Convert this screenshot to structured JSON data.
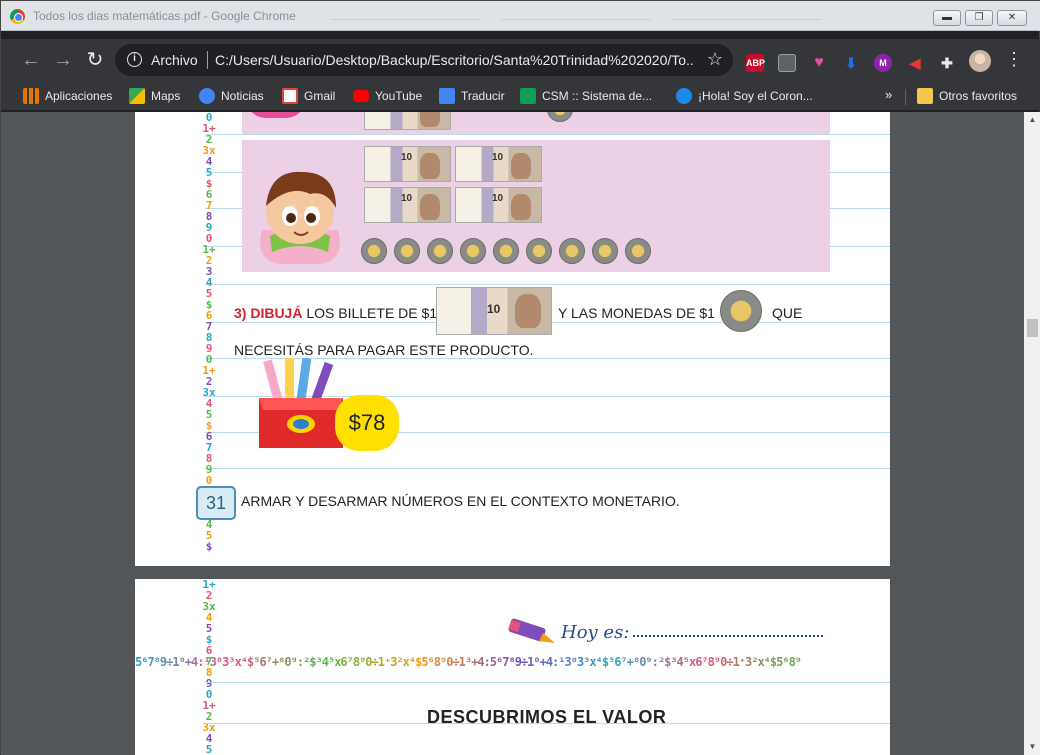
{
  "window": {
    "title": "Todos los dias matemáticas.pdf - Google Chrome",
    "minimize_label": "▬",
    "restore_label": "❐",
    "close_label": "✕"
  },
  "toolbar": {
    "back_icon": "←",
    "forward_icon": "→",
    "reload_icon": "↻",
    "scheme_label": "Archivo",
    "url": "C:/Users/Usuario/Desktop/Backup/Escritorio/Santa%20Trinidad%202020/To...",
    "bookmark_star": "☆",
    "extensions": [
      {
        "name": "adblock-plus-icon",
        "label": "ABP",
        "color": "#c70d2c"
      },
      {
        "name": "pdf-extension-icon",
        "label": "",
        "color": "#5f6368"
      },
      {
        "name": "heart-extension-icon",
        "label": "",
        "color": "#e05297"
      },
      {
        "name": "download-extension-icon",
        "label": "",
        "color": "#1a73e8"
      },
      {
        "name": "mu-extension-icon",
        "label": "",
        "color": "#8e24aa"
      },
      {
        "name": "screencast-extension-icon",
        "label": "",
        "color": "#e53935"
      },
      {
        "name": "puzzle-extensions-icon",
        "label": "",
        "color": "#35363a"
      }
    ]
  },
  "bookmarks": {
    "items": [
      {
        "label": "Aplicaciones",
        "icon": "apps-grid-icon",
        "color": "#e37400"
      },
      {
        "label": "Maps",
        "icon": "maps-icon",
        "color": "#34a853"
      },
      {
        "label": "Noticias",
        "icon": "news-icon",
        "color": "#4285f4"
      },
      {
        "label": "Gmail",
        "icon": "gmail-icon",
        "color": "#ea4335"
      },
      {
        "label": "YouTube",
        "icon": "youtube-icon",
        "color": "#ff0000"
      },
      {
        "label": "Traducir",
        "icon": "translate-icon",
        "color": "#4285f4"
      },
      {
        "label": "CSM :: Sistema de...",
        "icon": "csm-icon",
        "color": "#0f9d58"
      },
      {
        "label": "¡Hola! Soy el Coron...",
        "icon": "chat-bot-icon",
        "color": "#1e88e5"
      }
    ],
    "more_label": "»",
    "other_label": "Otros favoritos"
  },
  "pdf": {
    "bill_value": "10",
    "instruction_prefix": "3) DIBUJÁ",
    "instruction_part1": " LOS BILLETE DE $10",
    "instruction_part2": "Y LAS MONEDAS DE $1",
    "instruction_part3": "QUE",
    "instruction_line2": "NECESITÁS PARA PAGAR ESTE PRODUCTO.",
    "price": "$78",
    "page_number": "31",
    "footer": "ARMAR Y DESARMAR NÚMEROS EN EL CONTEXTO MONETARIO.",
    "hoy_es": "Hoy es:",
    "next_title": "DESCUBRIMOS EL VALOR",
    "number_band": "5⁶7⁸9÷1⁰+4:¹3⁰3³x⁴$⁵6⁷+⁸0⁹:²$³4⁵x6⁷8⁹0÷1⁺3²x⁴$5⁶8⁹0÷1³+4:5⁶7⁸9÷1⁰+4:¹3⁰3³x⁴$⁵6⁷+⁸0⁹:²$³4⁵x6⁷8⁹0÷1⁺3²x⁴$5⁶8⁹"
  }
}
